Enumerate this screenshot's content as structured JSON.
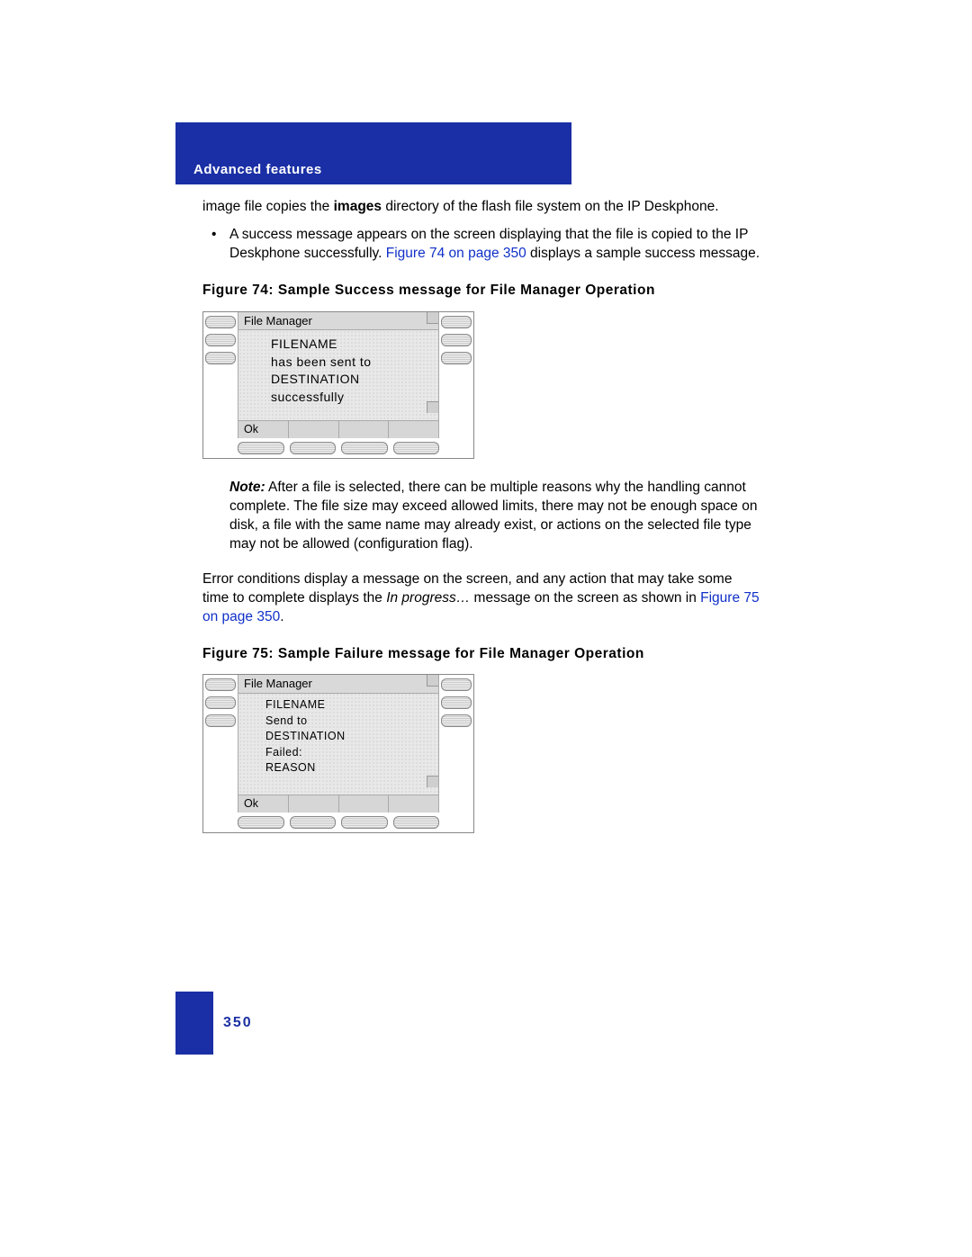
{
  "header": {
    "section_title": "Advanced features"
  },
  "paragraphs": {
    "intro_pre": "image file copies the ",
    "intro_bold": "images",
    "intro_post": " directory of the flash file system on the IP Deskphone.",
    "bullet_pre": "A success message appears on the screen displaying that the file is copied to the IP Deskphone successfully. ",
    "bullet_link": "Figure 74 on page 350",
    "bullet_post": " displays a sample success message.",
    "note_label": "Note:",
    "note_body": " After a file is selected, there can be multiple reasons why the handling cannot complete. The file size may exceed allowed limits, there may not be enough space on disk, a file with the same name may already exist, or actions on the selected file type may not be allowed (configuration flag).",
    "error_pre": "Error conditions display a message on the screen, and any action that may take some time to complete displays the ",
    "error_italic": "In progress…",
    "error_mid": " message on the screen as shown in ",
    "error_link": "Figure 75 on page 350",
    "error_post": "."
  },
  "figures": {
    "fig74_caption": "Figure 74: Sample Success message for File Manager Operation",
    "fig75_caption": "Figure 75: Sample Failure message for File Manager Operation"
  },
  "phone74": {
    "title": "File Manager",
    "line1": "FILENAME",
    "line2": "has been sent to",
    "line3": "DESTINATION",
    "line4": "successfully",
    "softkey1": "Ok"
  },
  "phone75": {
    "title": "File Manager",
    "line1": "FILENAME",
    "line2": "Send to",
    "line3": "DESTINATION",
    "line4": "Failed:",
    "line5": "REASON",
    "softkey1": "Ok"
  },
  "footer": {
    "page_number": "350"
  }
}
